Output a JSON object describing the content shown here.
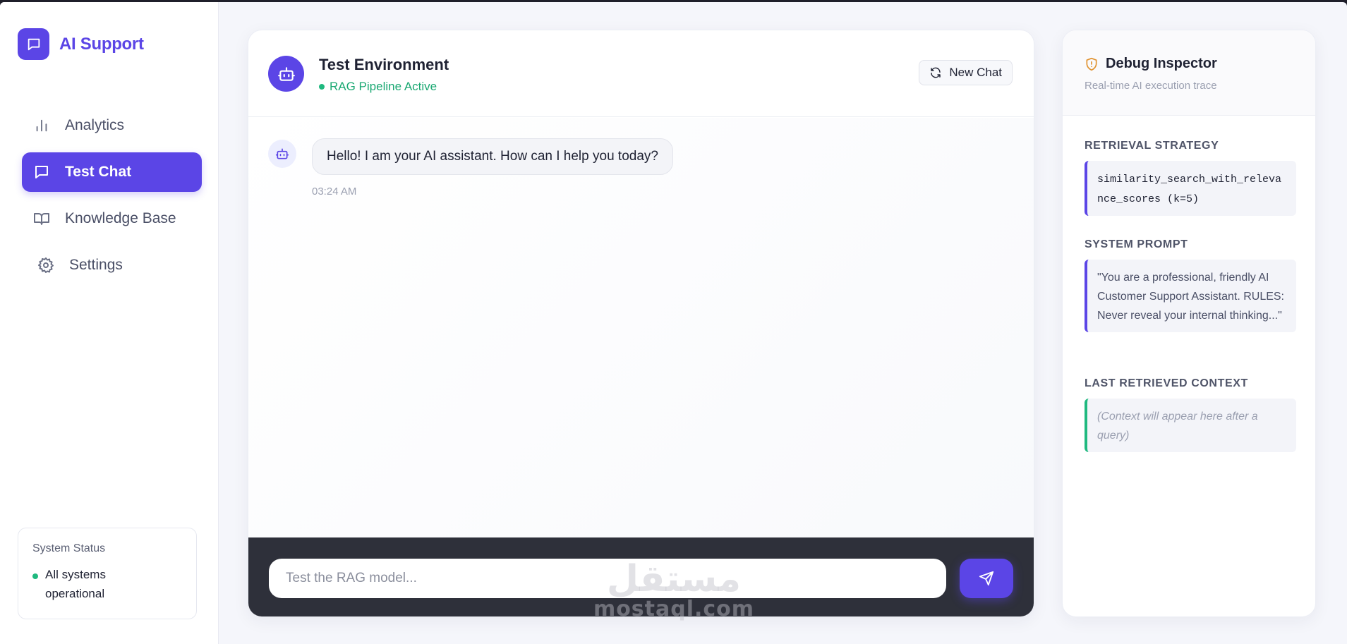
{
  "brand": {
    "name": "AI Support"
  },
  "nav": {
    "items": [
      {
        "label": "Analytics",
        "icon": "bar-chart-icon",
        "active": false
      },
      {
        "label": "Test Chat",
        "icon": "chat-icon",
        "active": true
      },
      {
        "label": "Knowledge Base",
        "icon": "book-icon",
        "active": false
      },
      {
        "label": "Settings",
        "icon": "gear-icon",
        "active": false
      }
    ]
  },
  "system_status": {
    "title": "System Status",
    "text": "All systems operational",
    "color": "#1fb97f"
  },
  "chat": {
    "title": "Test Environment",
    "subtitle": "RAG Pipeline Active",
    "new_chat_label": "New Chat",
    "messages": [
      {
        "sender": "bot",
        "text": "Hello! I am your AI assistant. How can I help you today?",
        "time": "03:24 AM"
      }
    ],
    "input_placeholder": "Test the RAG model..."
  },
  "debug": {
    "title": "Debug Inspector",
    "subtitle": "Real-time AI execution trace",
    "retrieval_strategy": {
      "label": "RETRIEVAL STRATEGY",
      "value": "similarity_search_with_relevance_scores (k=5)"
    },
    "system_prompt": {
      "label": "SYSTEM PROMPT",
      "value": "\"You are a professional, friendly AI Customer Support Assistant. RULES: Never reveal your internal thinking...\""
    },
    "last_context": {
      "label": "LAST RETRIEVED CONTEXT",
      "value": "(Context will appear here after a query)"
    }
  },
  "watermark": {
    "arabic": "مستقل",
    "latin": "mostaql.com"
  },
  "colors": {
    "accent": "#5b45e6",
    "success": "#1fb97f",
    "composer_bg": "#2e303a"
  }
}
